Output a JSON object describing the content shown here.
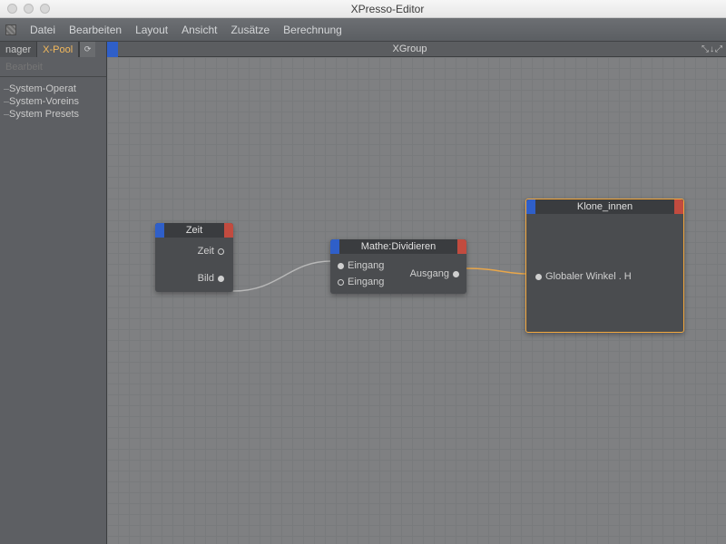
{
  "window": {
    "title": "XPresso-Editor"
  },
  "menu": [
    "Datei",
    "Bearbeiten",
    "Layout",
    "Ansicht",
    "Zusätze",
    "Berechnung"
  ],
  "sidebar": {
    "tabs": [
      {
        "label": "nager",
        "active": false
      },
      {
        "label": "X-Pool",
        "active": true
      }
    ],
    "search_label": "Bearbeit",
    "items": [
      "System-Operat",
      "System-Voreins",
      "System Presets"
    ]
  },
  "canvas": {
    "title": "XGroup",
    "corner_icons": [
      "resize-diag-icon",
      "arrow-down-icon",
      "resize-diag-icon"
    ]
  },
  "nodes": {
    "zeit": {
      "title": "Zeit",
      "outputs": [
        {
          "label": "Zeit",
          "connected": false
        },
        {
          "label": "Bild",
          "connected": true
        }
      ]
    },
    "mathe": {
      "title": "Mathe:Dividieren",
      "inputs": [
        {
          "label": "Eingang",
          "connected": true
        },
        {
          "label": "Eingang",
          "connected": false
        }
      ],
      "outputs": [
        {
          "label": "Ausgang",
          "connected": true
        }
      ]
    },
    "klone": {
      "title": "Klone_innen",
      "inputs": [
        {
          "label": "Globaler Winkel . H",
          "connected": true
        }
      ]
    }
  }
}
